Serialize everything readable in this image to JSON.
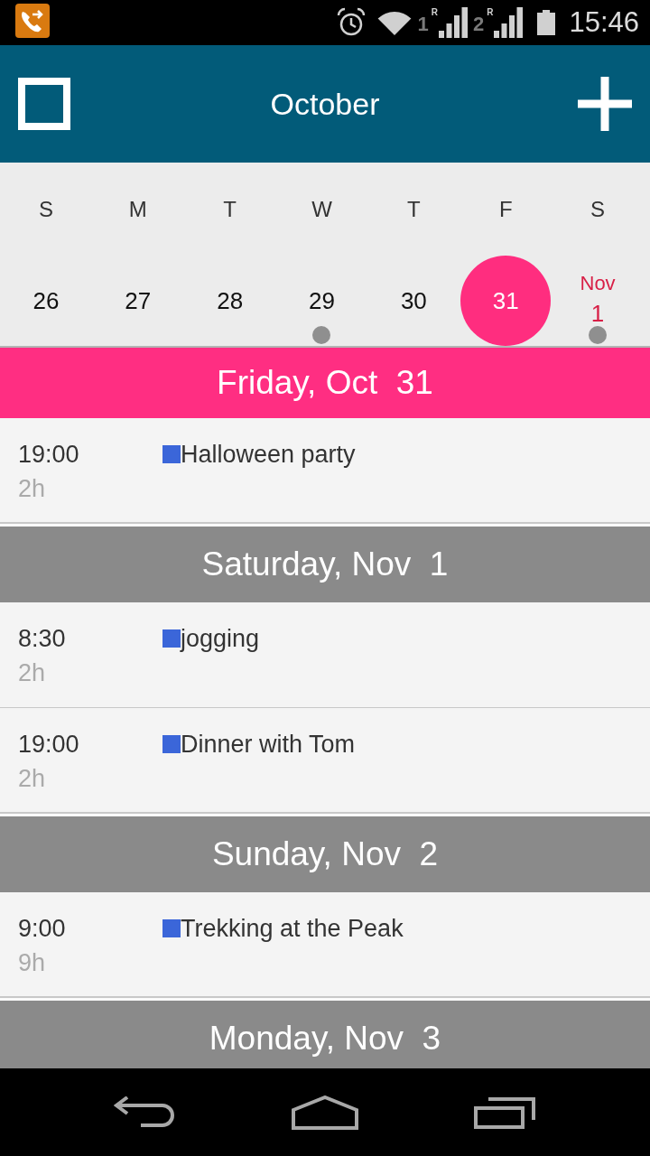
{
  "status_bar": {
    "signals": [
      {
        "sim": "1",
        "roaming": "R"
      },
      {
        "sim": "2",
        "roaming": "R"
      }
    ],
    "time": "15:46"
  },
  "app_bar": {
    "title": "October"
  },
  "week": {
    "weekdays": [
      "S",
      "M",
      "T",
      "W",
      "T",
      "F",
      "S"
    ],
    "dates": [
      {
        "day": "26",
        "selected": false,
        "has_events": false
      },
      {
        "day": "27",
        "selected": false,
        "has_events": false
      },
      {
        "day": "28",
        "selected": false,
        "has_events": false
      },
      {
        "day": "29",
        "selected": false,
        "has_events": true
      },
      {
        "day": "30",
        "selected": false,
        "has_events": false
      },
      {
        "day": "31",
        "selected": true,
        "has_events": false
      },
      {
        "day": "1",
        "month": "Nov",
        "selected": false,
        "has_events": true
      }
    ]
  },
  "days": [
    {
      "title": "Friday, Oct  31",
      "selected": true,
      "events": [
        {
          "time": "19:00",
          "duration": "2h",
          "title": "Halloween party",
          "color": "#3b66d9"
        }
      ]
    },
    {
      "title": "Saturday, Nov  1",
      "selected": false,
      "events": [
        {
          "time": "8:30",
          "duration": "2h",
          "title": "jogging",
          "color": "#3b66d9"
        },
        {
          "time": "19:00",
          "duration": "2h",
          "title": "Dinner with Tom",
          "color": "#3b66d9"
        }
      ]
    },
    {
      "title": "Sunday, Nov  2",
      "selected": false,
      "events": [
        {
          "time": "9:00",
          "duration": "9h",
          "title": "Trekking at the Peak",
          "color": "#3b66d9"
        }
      ]
    },
    {
      "title": "Monday, Nov  3",
      "selected": false
    }
  ]
}
